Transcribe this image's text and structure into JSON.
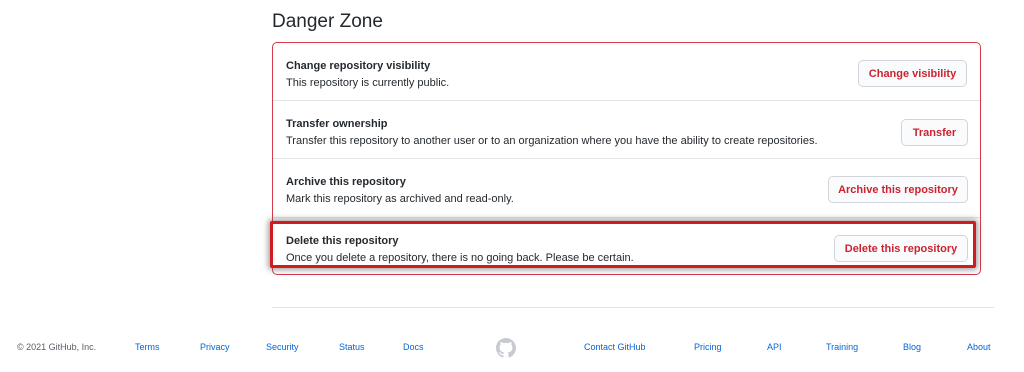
{
  "danger_zone": {
    "title": "Danger Zone",
    "rows": [
      {
        "title": "Change repository visibility",
        "description": "This repository is currently public.",
        "button": "Change visibility"
      },
      {
        "title": "Transfer ownership",
        "description": "Transfer this repository to another user or to an organization where you have the ability to create repositories.",
        "button": "Transfer"
      },
      {
        "title": "Archive this repository",
        "description": "Mark this repository as archived and read-only.",
        "button": "Archive this repository"
      },
      {
        "title": "Delete this repository",
        "description": "Once you delete a repository, there is no going back. Please be certain.",
        "button": "Delete this repository"
      }
    ],
    "accent_color": "#d73a49",
    "button_text_color": "#cb2431",
    "highlight_color": "#d01c1c"
  },
  "footer": {
    "copyright": "© 2021 GitHub, Inc.",
    "links_left": [
      "Terms",
      "Privacy",
      "Security",
      "Status",
      "Docs"
    ],
    "logo_icon": "github-mark-icon",
    "links_right": [
      "Contact GitHub",
      "Pricing",
      "API",
      "Training",
      "Blog",
      "About"
    ],
    "link_color": "#0366d6"
  }
}
